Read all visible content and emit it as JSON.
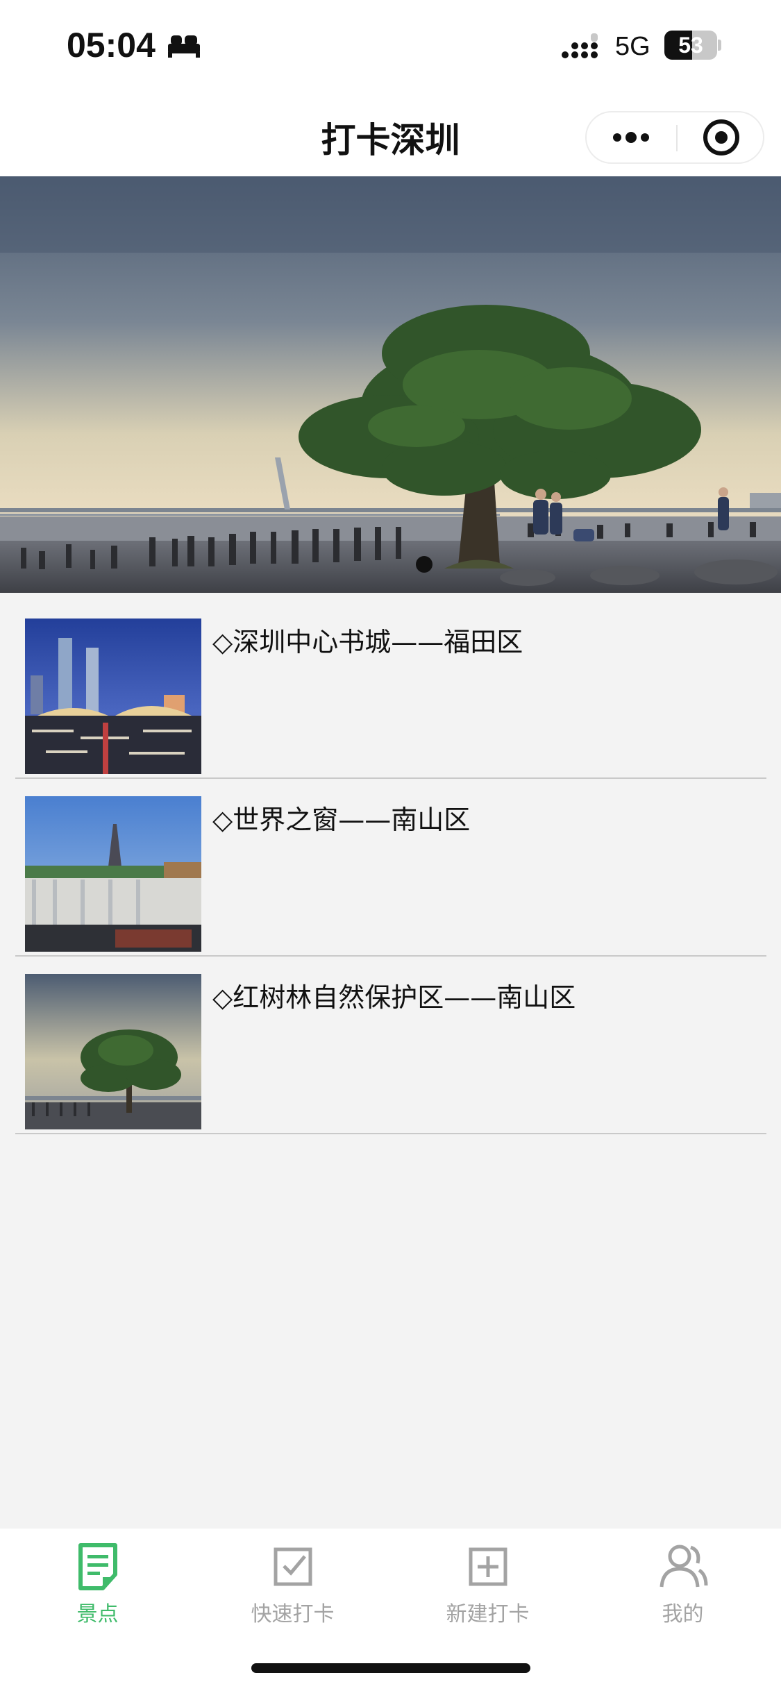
{
  "status_bar": {
    "time": "05:04",
    "network": "5G",
    "battery": "53",
    "battery_level": 0.53,
    "icons": [
      "bed-icon",
      "signal-icon",
      "battery-icon"
    ]
  },
  "nav": {
    "title": "打卡深圳",
    "more_icon": "more-dots-icon",
    "close_icon": "target-close-icon"
  },
  "banner": {
    "image": "mangrove-tree-photo",
    "dots": 1
  },
  "spots": [
    {
      "title": "◇深圳中心书城——福田区",
      "thumb": "book-city-photo"
    },
    {
      "title": "◇世界之窗——南山区",
      "thumb": "window-of-world-photo"
    },
    {
      "title": "◇红树林自然保护区——南山区",
      "thumb": "mangrove-photo"
    }
  ],
  "tabs": [
    {
      "label": "景点",
      "icon": "note-icon",
      "active": true
    },
    {
      "label": "快速打卡",
      "icon": "checkbox-icon",
      "active": false
    },
    {
      "label": "新建打卡",
      "icon": "plus-box-icon",
      "active": false
    },
    {
      "label": "我的",
      "icon": "users-icon",
      "active": false
    }
  ],
  "colors": {
    "accent": "#3fbb6a",
    "inactive": "#a3a3a3",
    "background": "#f3f3f3"
  }
}
